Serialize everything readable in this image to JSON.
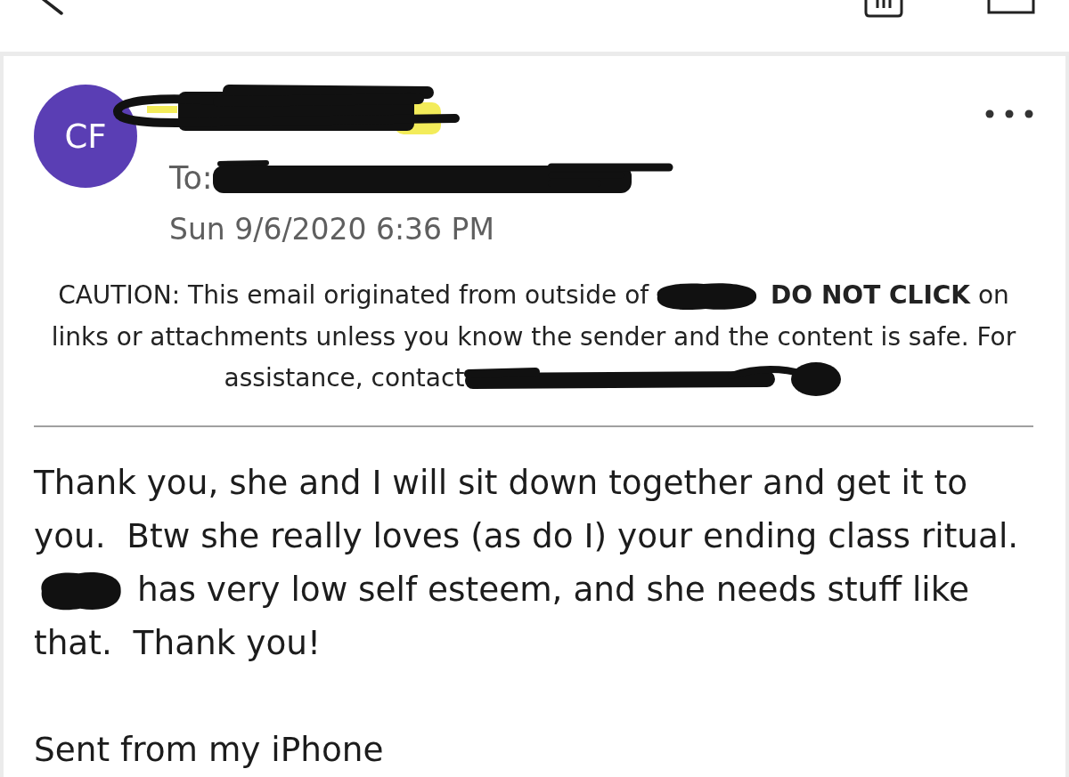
{
  "message": {
    "avatar": {
      "initials": "CF"
    },
    "sender": {
      "kind": "loop_scribble"
    },
    "to": {
      "label": "To:",
      "value": {
        "kind": "scribble"
      }
    },
    "date": "Sun 9/6/2020 6:36 PM",
    "caution": [
      {
        "kind": "text",
        "text": "CAUTION: This email originated from outside of"
      },
      {
        "kind": "blob"
      },
      {
        "kind": "text",
        "text": " **DO NOT CLICK** on links or attachments unless you know the sender and the content is safe. For assistance, contact"
      },
      {
        "kind": "scribble"
      }
    ],
    "body": [
      {
        "segments": [
          {
            "kind": "text",
            "text": "Thank you, she and I will sit down together and get it to you.  Btw she really loves (as do I) your ending class ritual. "
          },
          {
            "kind": "blob"
          },
          {
            "kind": "text",
            "text": " has very low self esteem, and she needs stuff like that.  Thank you!"
          }
        ]
      },
      {
        "segments": [
          {
            "kind": "text",
            "text": "Sent from my iPhone"
          }
        ]
      }
    ]
  }
}
